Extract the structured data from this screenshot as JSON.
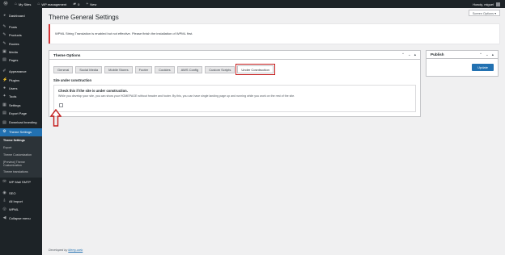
{
  "admin_bar": {
    "my_sites": "My Sites",
    "site_name": "WP management",
    "comments_count": "0",
    "new_label": "New",
    "howdy": "Howdy, miguel"
  },
  "sidebar": {
    "items": [
      {
        "label": "Dashboard",
        "icon": "dashboard-icon",
        "glyph": "◕"
      },
      {
        "label": "Posts",
        "icon": "pin-icon",
        "glyph": "✎"
      },
      {
        "label": "Products",
        "icon": "pin-icon",
        "glyph": "✎"
      },
      {
        "label": "Routes",
        "icon": "pin-icon",
        "glyph": "✎"
      },
      {
        "label": "Media",
        "icon": "media-icon",
        "glyph": "▣"
      },
      {
        "label": "Pages",
        "icon": "pages-icon",
        "glyph": "▤"
      },
      {
        "label": "Appearance",
        "icon": "brush-icon",
        "glyph": "✐"
      },
      {
        "label": "Plugins",
        "icon": "plug-icon",
        "glyph": "⚡"
      },
      {
        "label": "Users",
        "icon": "user-icon",
        "glyph": "●"
      },
      {
        "label": "Tools",
        "icon": "wrench-icon",
        "glyph": "✦"
      },
      {
        "label": "Settings",
        "icon": "settings-icon",
        "glyph": "▦"
      },
      {
        "label": "Export Page",
        "icon": "export-icon",
        "glyph": "▤"
      },
      {
        "label": "Download branding",
        "icon": "download-icon",
        "glyph": "▤"
      },
      {
        "label": "Theme Settings",
        "icon": "gear-icon",
        "glyph": "⚙"
      }
    ],
    "submenu": [
      {
        "label": "Theme Settings"
      },
      {
        "label": "Export"
      },
      {
        "label": "Theme Customization"
      },
      {
        "label": "[Preview] Theme Customization"
      },
      {
        "label": "Theme translations"
      }
    ],
    "bottom_items": [
      {
        "label": "WP Mail SMTP",
        "icon": "mail-icon",
        "glyph": "✉"
      },
      {
        "label": "SEO",
        "icon": "seo-icon",
        "glyph": "◉"
      },
      {
        "label": "All Import",
        "icon": "import-icon",
        "glyph": "⇩"
      },
      {
        "label": "WPML",
        "icon": "wpml-icon",
        "glyph": "◎"
      },
      {
        "label": "Collapse menu",
        "icon": "collapse-icon",
        "glyph": "◀"
      }
    ]
  },
  "header": {
    "title": "Theme General Settings",
    "screen_options": "Screen Options ▾"
  },
  "notice": {
    "text": "WPML String Translation is enabled but not effective. Please finish the installation of WPML first."
  },
  "options_box": {
    "title": "Theme Options",
    "tabs": [
      {
        "label": "General"
      },
      {
        "label": "Social Media"
      },
      {
        "label": "Mobile Stores"
      },
      {
        "label": "Footer"
      },
      {
        "label": "Cookies"
      },
      {
        "label": "AWS Config"
      },
      {
        "label": "Custom Scripts"
      },
      {
        "label": "Under Cosntruction"
      }
    ],
    "section_title": "Site under construction",
    "field_heading": "Check this if the site is under construction.",
    "field_desc": "While you develop your site, you can show your HOMEPAGE without header and footer. By this, you can have single landing page up and running while you work on the rest of the site."
  },
  "publish_box": {
    "title": "Publish",
    "update_label": "Update"
  },
  "footer": {
    "prefix": "Developed by",
    "link": "Merry-web"
  },
  "colors": {
    "admin_dark": "#1d2327",
    "accent": "#2271b1",
    "annotation_red": "#c41a1a"
  }
}
